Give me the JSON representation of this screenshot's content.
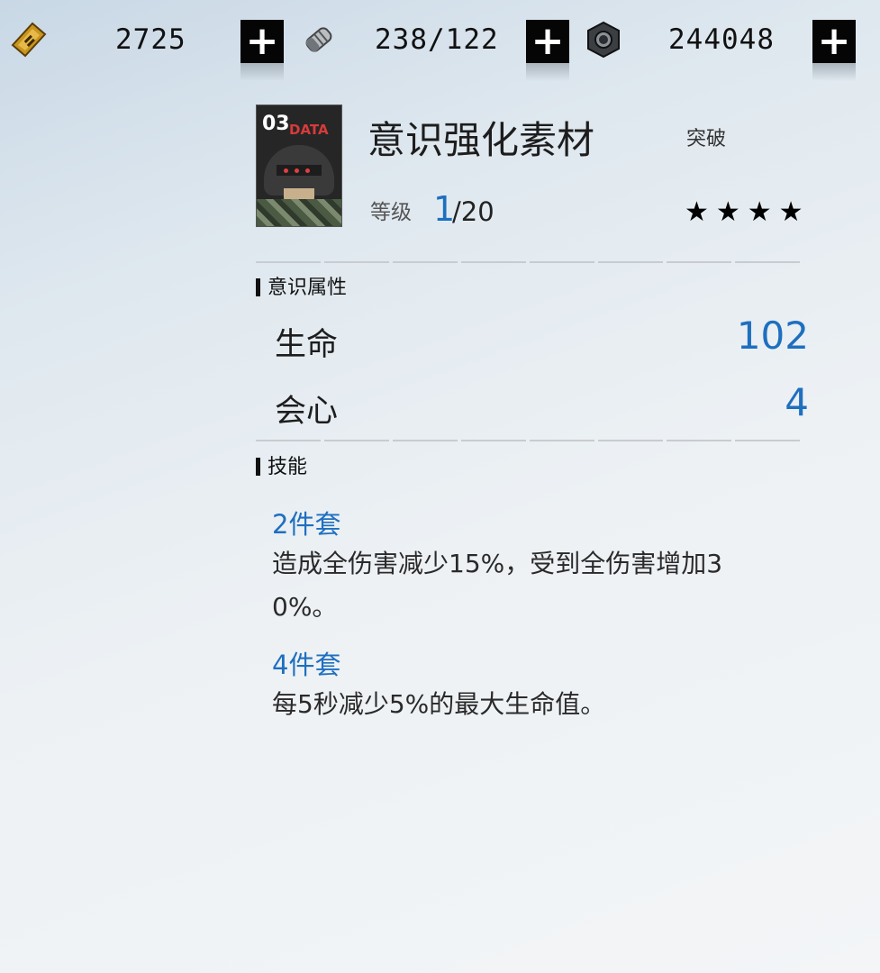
{
  "resources": [
    {
      "icon": "gold-card-icon",
      "value": "2725"
    },
    {
      "icon": "silver-capsule-icon",
      "value": "238/122"
    },
    {
      "icon": "hex-nut-icon",
      "value": "244048"
    }
  ],
  "add_label": "+",
  "item": {
    "thumbnail_number": "03",
    "thumbnail_text": "DATA",
    "name": "意识强化素材",
    "breakthrough_label": "突破",
    "level_label": "等级",
    "level_current": "1",
    "level_max": "/20",
    "stars": "★★★★",
    "rarity": 4
  },
  "attributes": {
    "section_title": "意识属性",
    "items": [
      {
        "name": "生命",
        "value": "102"
      },
      {
        "name": "会心",
        "value": "4"
      }
    ]
  },
  "skills": {
    "section_title": "技能",
    "sets": [
      {
        "title": "2件套",
        "description": "造成全伤害减少15%，受到全伤害增加30%。"
      },
      {
        "title": "4件套",
        "description": "每5秒减少5%的最大生命值。"
      }
    ]
  },
  "colors": {
    "accent": "#1e6fbf",
    "text": "#1d1d1d"
  }
}
